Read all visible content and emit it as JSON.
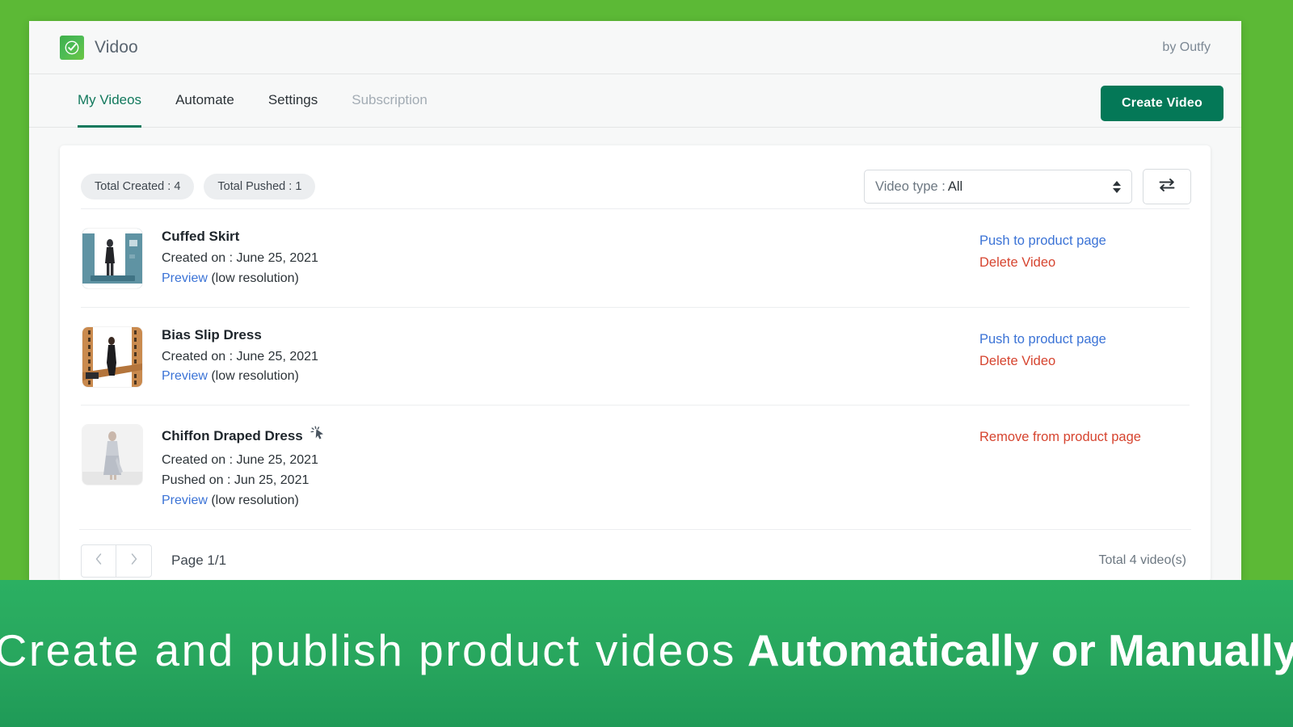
{
  "header": {
    "brand_name": "Vidoo",
    "brand_icon": "check-circle-icon",
    "by_line": "by Outfy"
  },
  "nav": {
    "tabs": [
      {
        "label": "My Videos",
        "state": "active"
      },
      {
        "label": "Automate",
        "state": "normal"
      },
      {
        "label": "Settings",
        "state": "normal"
      },
      {
        "label": "Subscription",
        "state": "muted"
      }
    ],
    "create_button": "Create Video"
  },
  "toolbar": {
    "pills": [
      "Total Created : 4",
      "Total Pushed : 1"
    ],
    "filter": {
      "label": "Video type :",
      "value": "All",
      "options": [
        "All"
      ]
    },
    "swap_button_icon": "exchange-arrows-icon"
  },
  "videos": [
    {
      "title": "Cuffed Skirt",
      "created": "Created on : June 25, 2021",
      "pushed": "",
      "preview_link": "Preview",
      "preview_suffix": " (low resolution)",
      "thumb_style": "teal-frame",
      "has_cursor_icon": false,
      "actions": [
        {
          "label": "Push to product page",
          "kind": "push"
        },
        {
          "label": "Delete Video",
          "kind": "delete"
        }
      ]
    },
    {
      "title": "Bias Slip Dress",
      "created": "Created on : June 25, 2021",
      "pushed": "",
      "preview_link": "Preview",
      "preview_suffix": " (low resolution)",
      "thumb_style": "film-strip",
      "has_cursor_icon": false,
      "actions": [
        {
          "label": "Push to product page",
          "kind": "push"
        },
        {
          "label": "Delete Video",
          "kind": "delete"
        }
      ]
    },
    {
      "title": "Chiffon Draped Dress",
      "created": "Created on : June 25, 2021",
      "pushed": "Pushed on : Jun 25, 2021",
      "preview_link": "Preview",
      "preview_suffix": " (low resolution)",
      "thumb_style": "plain-grey",
      "has_cursor_icon": true,
      "cursor_icon_name": "click-cursor-icon",
      "actions": [
        {
          "label": "Remove from product page",
          "kind": "remove"
        }
      ]
    }
  ],
  "pagination": {
    "prev_icon": "chevron-left-icon",
    "next_icon": "chevron-right-icon",
    "page_label": "Page 1/1",
    "total_label": "Total 4 video(s)"
  },
  "promo": {
    "light_text": "Create and publish product videos",
    "bold_text": "Automatically or Manually"
  },
  "colors": {
    "outer_background": "#5cb936",
    "banner_green_top": "#2bb062",
    "banner_green_bottom": "#1f9a57",
    "accent_teal": "#12795d",
    "create_button": "#047857",
    "link_blue": "#3b73d6",
    "danger_red": "#d6442f"
  }
}
